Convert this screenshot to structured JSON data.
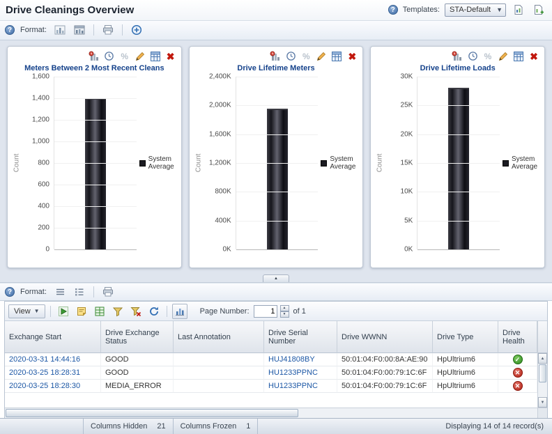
{
  "header": {
    "title": "Drive Cleanings Overview",
    "templates_label": "Templates:",
    "template_value": "STA-Default"
  },
  "toolbar": {
    "format_label": "Format:"
  },
  "chart_data": [
    {
      "type": "bar",
      "title": "Meters Between 2 Most Recent Cleans",
      "ylabel": "Count",
      "categories": [
        "System Average"
      ],
      "values": [
        1400
      ],
      "ylim": [
        0,
        1600
      ],
      "yticks": [
        "1,600",
        "1,400",
        "1,200",
        "1,000",
        "800",
        "600",
        "400",
        "200",
        "0"
      ],
      "legend_label": "System Average",
      "bar_color": "#1b1b22",
      "grid": true,
      "legend_position": "right"
    },
    {
      "type": "bar",
      "title": "Drive Lifetime Meters",
      "ylabel": "Count",
      "categories": [
        "System Average"
      ],
      "values": [
        1950000
      ],
      "ylim": [
        0,
        2400000
      ],
      "yticks": [
        "2,400K",
        "2,000K",
        "1,600K",
        "1,200K",
        "800K",
        "400K",
        "0K"
      ],
      "legend_label": "System Average",
      "bar_color": "#1b1b22",
      "grid": true,
      "legend_position": "right"
    },
    {
      "type": "bar",
      "title": "Drive Lifetime Loads",
      "ylabel": "Count",
      "categories": [
        "System Average"
      ],
      "values": [
        28000
      ],
      "ylim": [
        0,
        30000
      ],
      "yticks": [
        "30K",
        "25K",
        "20K",
        "15K",
        "10K",
        "5K",
        "0K"
      ],
      "legend_label": "System Average",
      "bar_color": "#1b1b22",
      "grid": true,
      "legend_position": "right"
    }
  ],
  "table_controls": {
    "view_label": "View",
    "page_number_label": "Page Number:",
    "page_value": "1",
    "page_of": "of 1"
  },
  "table": {
    "columns": [
      "Exchange Start",
      "Drive Exchange Status",
      "Last Annotation",
      "Drive Serial Number",
      "Drive WWNN",
      "Drive Type",
      "Drive Health"
    ],
    "rows": [
      {
        "exchange_start": "2020-03-31 14:44:16",
        "drive_exchange_status": "GOOD",
        "last_annotation": "",
        "drive_serial_number": "HUJ41808BY",
        "drive_wwnn": "50:01:04:F0:00:8A:AE:90",
        "drive_type": "HpUltrium6",
        "drive_health": "good"
      },
      {
        "exchange_start": "2020-03-25 18:28:31",
        "drive_exchange_status": "GOOD",
        "last_annotation": "",
        "drive_serial_number": "HU1233PPNC",
        "drive_wwnn": "50:01:04:F0:00:79:1C:6F",
        "drive_type": "HpUltrium6",
        "drive_health": "error"
      },
      {
        "exchange_start": "2020-03-25 18:28:30",
        "drive_exchange_status": "MEDIA_ERROR",
        "last_annotation": "",
        "drive_serial_number": "HU1233PPNC",
        "drive_wwnn": "50:01:04:F0:00:79:1C:6F",
        "drive_type": "HpUltrium6",
        "drive_health": "error"
      }
    ]
  },
  "footer": {
    "columns_hidden_label": "Columns Hidden",
    "columns_hidden_value": "21",
    "columns_frozen_label": "Columns Frozen",
    "columns_frozen_value": "1",
    "records_text": "Displaying 14 of 14 record(s)"
  }
}
